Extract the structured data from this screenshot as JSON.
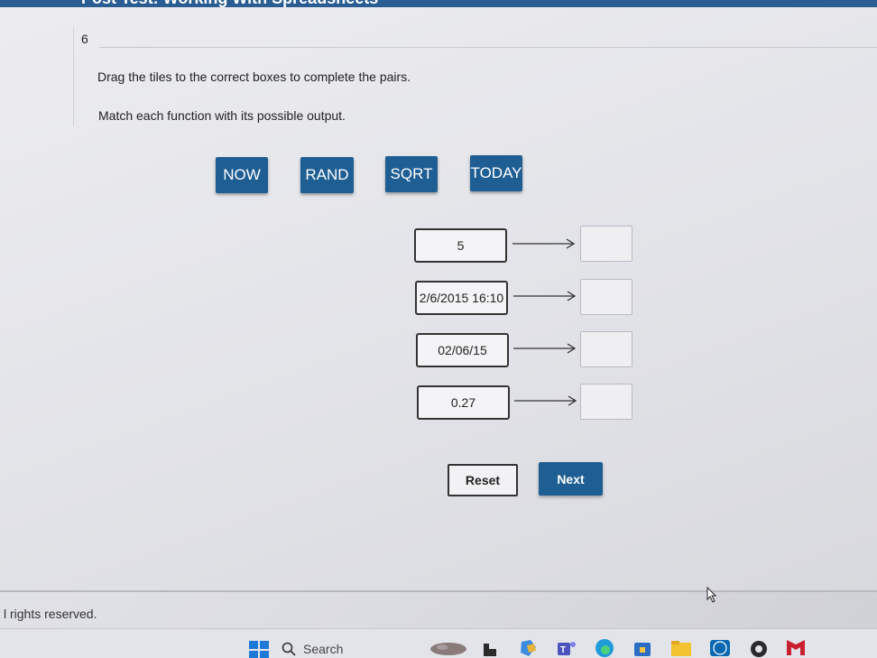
{
  "header": {
    "title_partial": "Post Test: Working With Spreadsheets"
  },
  "question": {
    "number": "6",
    "instruction": "Drag the tiles to the correct boxes to complete the pairs.",
    "prompt": "Match each function with its possible output."
  },
  "tiles": [
    "NOW",
    "RAND",
    "SQRT",
    "TODAY"
  ],
  "outputs": [
    "5",
    "2/6/2015 16:10",
    "02/06/15",
    "0.27"
  ],
  "buttons": {
    "reset": "Reset",
    "next": "Next"
  },
  "footer": {
    "text": "l rights reserved."
  },
  "taskbar": {
    "search_label": "Search",
    "icons": [
      "windows-start-icon",
      "search-icon",
      "widgets-icon",
      "file-explorer-icon",
      "copilot-icon",
      "teams-icon",
      "edge-icon",
      "store-icon",
      "folder-icon",
      "dell-icon",
      "chrome-icon",
      "mcafee-icon"
    ]
  },
  "colors": {
    "accent": "#1f5e93",
    "top_bar": "#2a5d92"
  }
}
